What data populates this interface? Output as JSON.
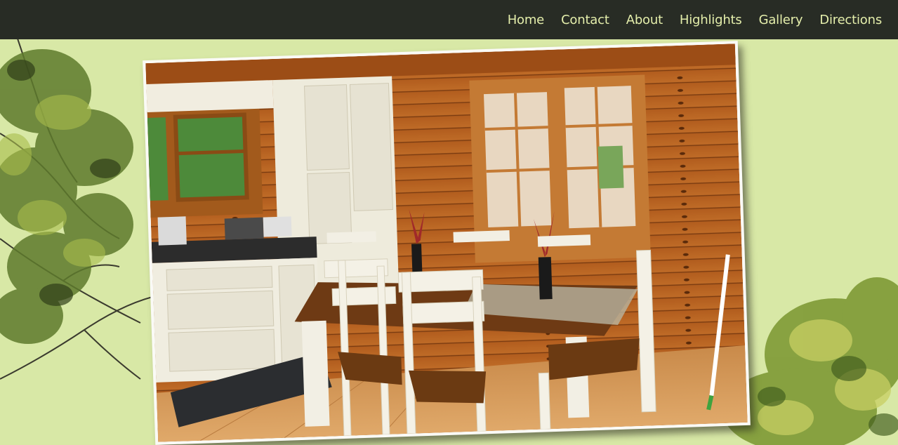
{
  "nav": {
    "items": [
      {
        "label": "Home"
      },
      {
        "label": "Contact"
      },
      {
        "label": "About"
      },
      {
        "label": "Highlights"
      },
      {
        "label": "Gallery"
      },
      {
        "label": "Directions"
      }
    ]
  },
  "photo": {
    "subject": "kitchen-dining-room-photo"
  },
  "colors": {
    "header_bg": "#282c25",
    "nav_text": "#e4eeab",
    "page_bg": "#d8e8a6"
  }
}
